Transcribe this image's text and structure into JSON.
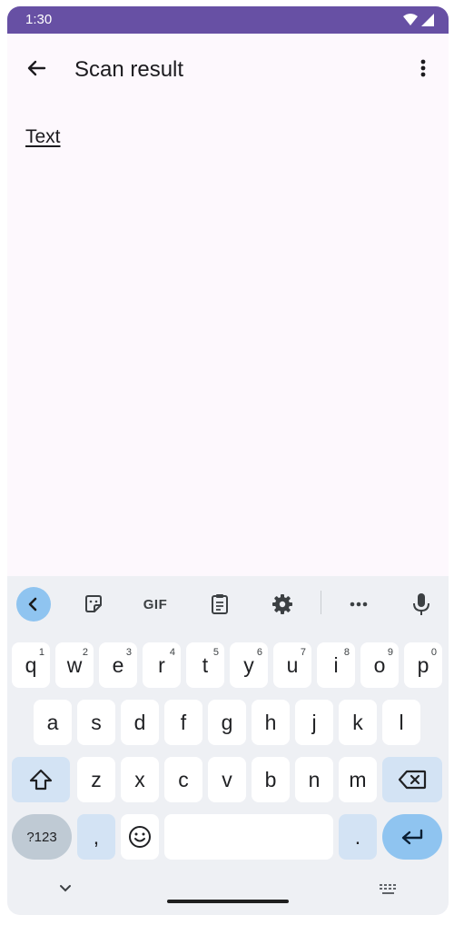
{
  "status": {
    "time": "1:30"
  },
  "app_bar": {
    "title": "Scan result"
  },
  "content": {
    "text": "Text"
  },
  "keyboard": {
    "toolbar": {
      "gif_label": "GIF"
    },
    "row1": [
      {
        "key": "q",
        "hint": "1"
      },
      {
        "key": "w",
        "hint": "2"
      },
      {
        "key": "e",
        "hint": "3"
      },
      {
        "key": "r",
        "hint": "4"
      },
      {
        "key": "t",
        "hint": "5"
      },
      {
        "key": "y",
        "hint": "6"
      },
      {
        "key": "u",
        "hint": "7"
      },
      {
        "key": "i",
        "hint": "8"
      },
      {
        "key": "o",
        "hint": "9"
      },
      {
        "key": "p",
        "hint": "0"
      }
    ],
    "row2": [
      "a",
      "s",
      "d",
      "f",
      "g",
      "h",
      "j",
      "k",
      "l"
    ],
    "row3": [
      "z",
      "x",
      "c",
      "v",
      "b",
      "n",
      "m"
    ],
    "row4": {
      "symbols": "?123",
      "comma": ",",
      "period": "."
    }
  },
  "colors": {
    "status_bar": "#6750a4",
    "accent_key": "#8fc4f0",
    "keyboard_bg": "#eef0f4"
  }
}
